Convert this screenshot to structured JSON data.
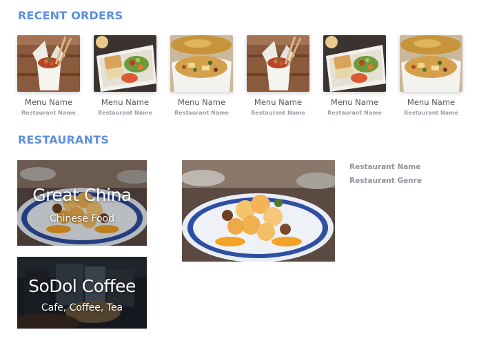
{
  "recent_orders": {
    "title": "RECENT ORDERS",
    "items": [
      {
        "menu_name": "Menu Name",
        "restaurant_name": "Restaurant Name",
        "image": "takeout-noodle-box"
      },
      {
        "menu_name": "Menu Name",
        "restaurant_name": "Restaurant Name",
        "image": "bento-tray"
      },
      {
        "menu_name": "Menu Name",
        "restaurant_name": "Restaurant Name",
        "image": "stir-fry-container"
      },
      {
        "menu_name": "Menu Name",
        "restaurant_name": "Restaurant Name",
        "image": "takeout-noodle-box"
      },
      {
        "menu_name": "Menu Name",
        "restaurant_name": "Restaurant Name",
        "image": "bento-tray"
      },
      {
        "menu_name": "Menu Name",
        "restaurant_name": "Restaurant Name",
        "image": "stir-fry-container"
      }
    ]
  },
  "restaurants": {
    "title": "RESTAURANTS",
    "cards": [
      {
        "name": "Great China",
        "genre": "Chinese Food",
        "image": "orange-chicken-plate"
      },
      {
        "name": "SoDol Coffee",
        "genre": "Cafe, Coffee, Tea",
        "image": "cafe-interior"
      }
    ],
    "detail": {
      "image": "orange-chicken-plate",
      "restaurant_name": "Restaurant Name",
      "restaurant_genre": "Restaurant Genre"
    }
  },
  "colors": {
    "accent": "#5b8fdb",
    "text": "#555a62",
    "muted": "#9aa0a8"
  }
}
